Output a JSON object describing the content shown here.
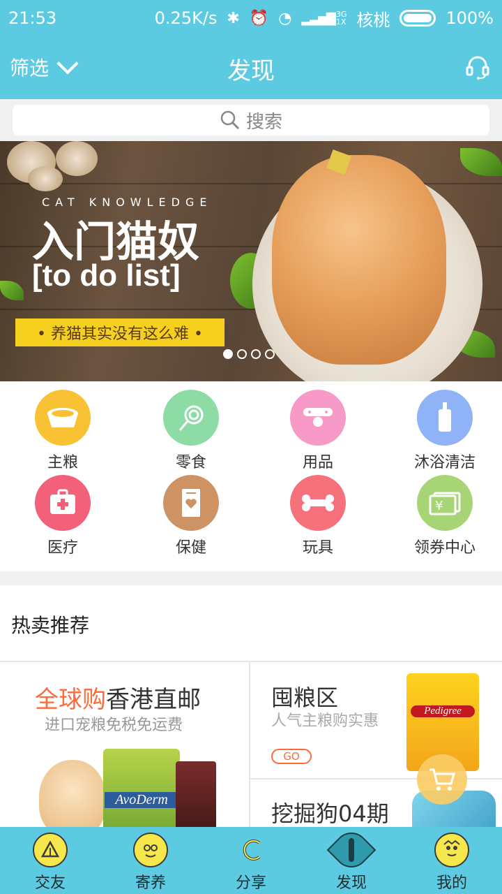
{
  "status_bar": {
    "time": "21:53",
    "network_speed": "0.25K/s",
    "signal_label_top": "3G",
    "signal_label_bottom": "1X",
    "carrier": "核桃",
    "battery": "100%"
  },
  "header": {
    "filter_label": "筛选",
    "title": "发现"
  },
  "search": {
    "placeholder": "搜索"
  },
  "banner": {
    "subtitle": "CAT KNOWLEDGE",
    "title": "入门猫奴",
    "todo": "[to do list]",
    "tagline": "• 养猫其实没有这么难 •",
    "slide_count": 4,
    "active_slide": 1
  },
  "categories": [
    {
      "label": "主粮",
      "icon": "food-bowl-icon",
      "color": "#f8c234"
    },
    {
      "label": "零食",
      "icon": "lollipop-icon",
      "color": "#8ddba5"
    },
    {
      "label": "用品",
      "icon": "collar-icon",
      "color": "#f89ac8"
    },
    {
      "label": "沐浴清洁",
      "icon": "shampoo-icon",
      "color": "#8fb3f6"
    },
    {
      "label": "医疗",
      "icon": "medical-kit-icon",
      "color": "#f2607a"
    },
    {
      "label": "保健",
      "icon": "health-box-icon",
      "color": "#cd9365"
    },
    {
      "label": "玩具",
      "icon": "bone-icon",
      "color": "#f7717d"
    },
    {
      "label": "领券中心",
      "icon": "coupon-icon",
      "color": "#a7d575"
    }
  ],
  "hot": {
    "title": "热卖推荐",
    "promo_global": {
      "title_highlight": "全球购",
      "title_rest": "香港直邮",
      "subtitle": "进口宠粮免税免运费",
      "brand": "AvoDerm"
    },
    "promo_food": {
      "title": "囤粮区",
      "subtitle": "人气主粮购实惠",
      "cta": "GO",
      "brand": "Pedigree"
    },
    "promo_dig": {
      "title": "挖掘狗04期"
    }
  },
  "bottom_nav": [
    {
      "label": "交友",
      "icon": "friends-icon"
    },
    {
      "label": "寄养",
      "icon": "foster-icon"
    },
    {
      "label": "分享",
      "icon": "share-icon"
    },
    {
      "label": "发现",
      "icon": "discover-eye-icon"
    },
    {
      "label": "我的",
      "icon": "profile-icon"
    }
  ],
  "colors": {
    "primary": "#5ccbe1",
    "accent": "#ff6a3a",
    "banner_strip": "#f6d01e"
  }
}
